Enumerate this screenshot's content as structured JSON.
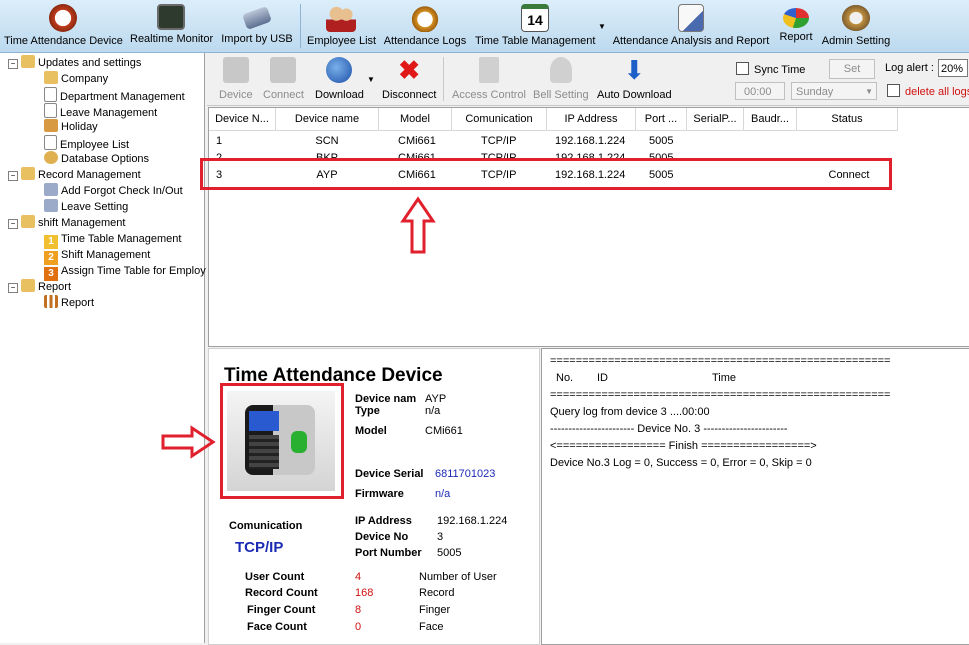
{
  "menubar": [
    {
      "label": "Time Attendance Device",
      "icon": "alarm-clock-icon"
    },
    {
      "label": "Realtime Monitor",
      "icon": "monitor-icon"
    },
    {
      "label": "Import by USB",
      "icon": "usb-drive-icon"
    },
    {
      "label": "Employee List",
      "icon": "users-icon"
    },
    {
      "label": "Attendance Logs",
      "icon": "clock-clipboard-icon"
    },
    {
      "label": "Time Table Management",
      "icon": "calendar-icon",
      "calendar_day": "14"
    },
    {
      "label": "Attendance Analysis and Report",
      "icon": "report-pen-icon"
    },
    {
      "label": "Report",
      "icon": "pie-chart-icon"
    },
    {
      "label": "Admin Setting",
      "icon": "admin-gear-icon"
    }
  ],
  "tree": {
    "groups": [
      {
        "label": "Updates and settings",
        "items": [
          "Company",
          "Department Management",
          "Leave Management",
          "Holiday",
          "Employee List",
          "Database Options"
        ]
      },
      {
        "label": "Record Management",
        "items": [
          "Add Forgot Check In/Out",
          "Leave Setting"
        ]
      },
      {
        "label": "shift Management",
        "items": [
          {
            "num": "1",
            "label": "Time Table Management"
          },
          {
            "num": "2",
            "label": "Shift Management"
          },
          {
            "num": "3",
            "label": "Assign Time Table for Employ"
          }
        ]
      },
      {
        "label": "Report",
        "items": [
          "Report"
        ]
      }
    ]
  },
  "toolbar": {
    "device": "Device",
    "connect": "Connect",
    "download": "Download",
    "disconnect": "Disconnect",
    "access_control": "Access Control",
    "bell_setting": "Bell Setting",
    "auto_download": "Auto Download",
    "sync_time": "Sync Time",
    "set": "Set",
    "time_value": "00:00",
    "day_value": "Sunday",
    "log_alert": "Log alert :",
    "log_alert_value": "20%",
    "delete_all_logs": "delete all logs"
  },
  "grid": {
    "columns": [
      "Device N...",
      "Device name",
      "Model",
      "Comunication",
      "IP Address",
      "Port ...",
      "SerialP...",
      "Baudr...",
      "Status"
    ],
    "rows": [
      [
        "1",
        "SCN",
        "CMi661",
        "TCP/IP",
        "192.168.1.224",
        "5005",
        "",
        "",
        ""
      ],
      [
        "2",
        "BKP",
        "CMi661",
        "TCP/IP",
        "192.168.1.224",
        "5005",
        "",
        "",
        ""
      ],
      [
        "3",
        "AYP",
        "CMi661",
        "TCP/IP",
        "192.168.1.224",
        "5005",
        "",
        "",
        "Connect"
      ]
    ]
  },
  "details": {
    "title": "Time Attendance Device",
    "device_name_label": "Device nam",
    "device_name_value": "AYP",
    "type_label": "Type",
    "type_value": "n/a",
    "model_label": "Model",
    "model_value": "CMi661",
    "serial_label": "Device Serial",
    "serial_value": "6811701023",
    "firmware_label": "Firmware",
    "firmware_value": "n/a",
    "comm_label": "Comunication",
    "comm_value": "TCP/IP",
    "ip_label": "IP Address",
    "ip_value": "192.168.1.224",
    "devno_label": "Device No",
    "devno_value": "3",
    "port_label": "Port Number",
    "port_value": "5005",
    "counts": [
      {
        "label": "User Count",
        "value": "4",
        "desc": "Number of User"
      },
      {
        "label": "Record Count",
        "value": "168",
        "desc": "Record"
      },
      {
        "label": "Finger Count",
        "value": "8",
        "desc": "Finger"
      },
      {
        "label": "Face Count",
        "value": "0",
        "desc": "Face"
      }
    ]
  },
  "log": {
    "sep": "=====================================================",
    "col_no": "No.",
    "col_id": "ID",
    "col_time": "Time",
    "line1": "Query log from device 3 ....00:00",
    "line2": "----------------------- Device No. 3 -----------------------",
    "line3": "<================= Finish =================>",
    "line4": "Device No.3  Log = 0, Success = 0, Error = 0, Skip = 0"
  },
  "colors": {
    "highlight": "#e0202c",
    "accent_blue": "#1c2bb4",
    "value_red": "#d01010"
  }
}
